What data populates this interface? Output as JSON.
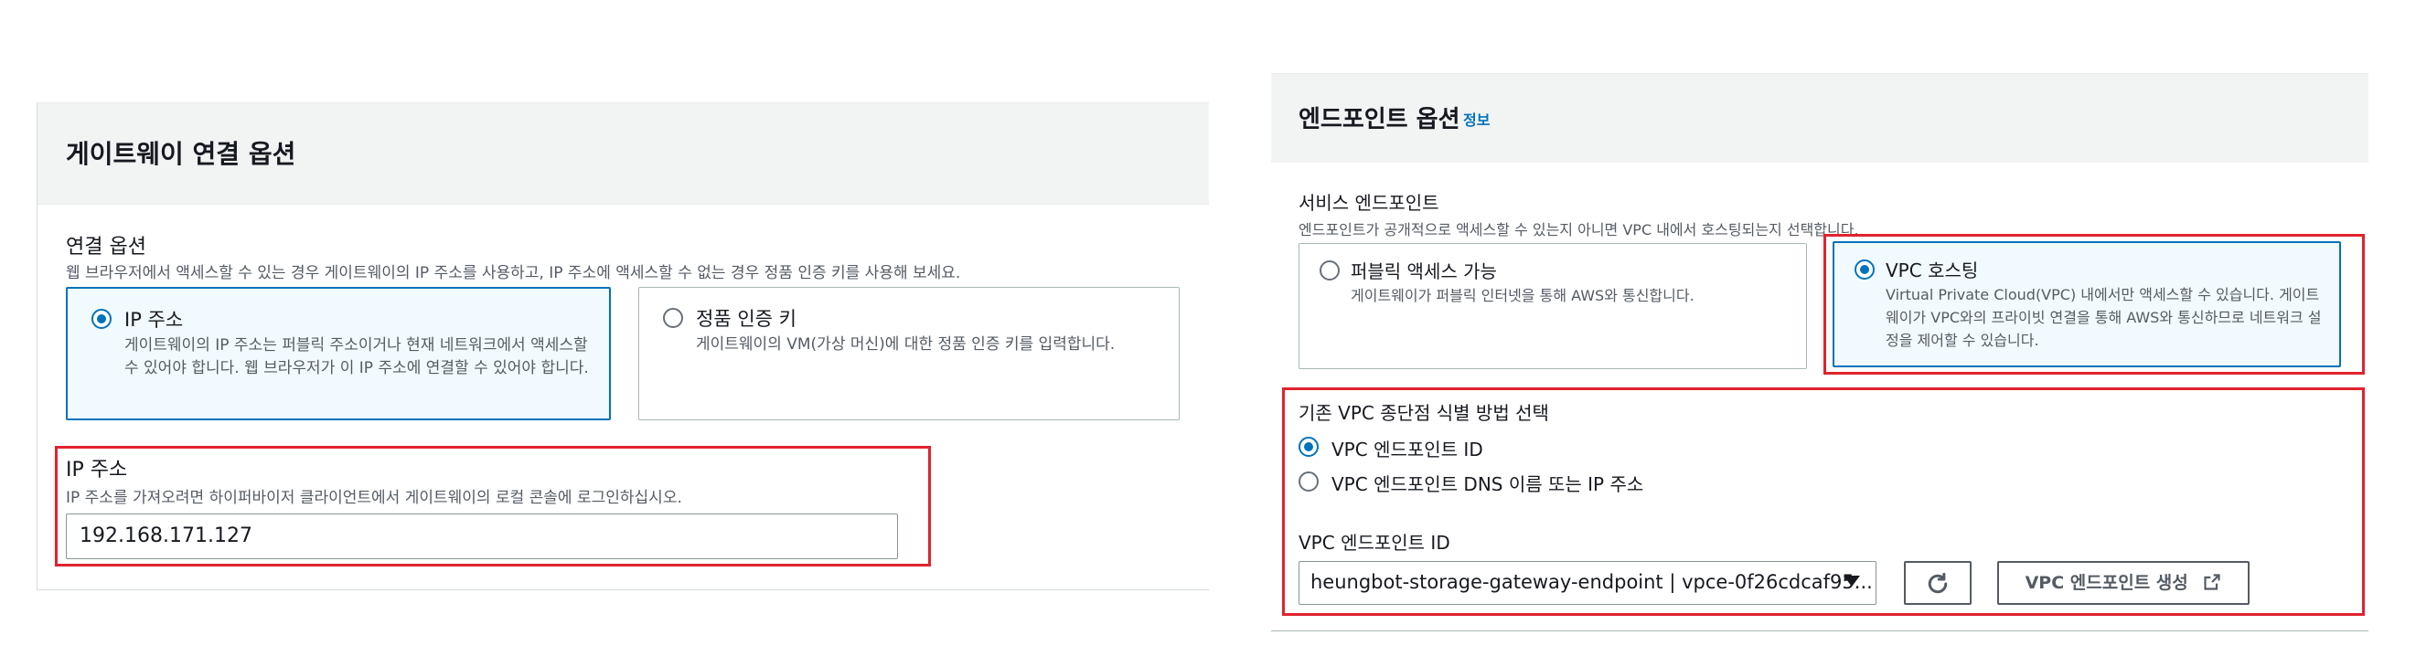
{
  "gateway_connection": {
    "title": "게이트웨이 연결 옵션",
    "connection_label": "연결 옵션",
    "connection_desc": "웹 브라우저에서 액세스할 수 있는 경우 게이트웨이의 IP 주소를 사용하고, IP 주소에 액세스할 수 없는 경우 정품 인증 키를 사용해 보세요.",
    "options": [
      {
        "title": "IP 주소",
        "desc": "게이트웨이의 IP 주소는 퍼블릭 주소이거나 현재 네트워크에서 액세스할 수 있어야 합니다. 웹 브라우저가 이 IP 주소에 연결할 수 있어야 합니다.",
        "selected": true
      },
      {
        "title": "정품 인증 키",
        "desc": "게이트웨이의 VM(가상 머신)에 대한 정품 인증 키를 입력합니다.",
        "selected": false
      }
    ],
    "ip_label": "IP 주소",
    "ip_desc": "IP 주소를 가져오려면 하이퍼바이저 클라이언트에서 게이트웨이의 로컬 콘솔에 로그인하십시오.",
    "ip_value": "192.168.171.127"
  },
  "endpoint_options": {
    "title": "엔드포인트 옵션",
    "info_link": "정보",
    "service_label": "서비스 엔드포인트",
    "service_desc": "엔드포인트가 공개적으로 액세스할 수 있는지 아니면 VPC 내에서 호스팅되는지 선택합니다.",
    "options": [
      {
        "title": "퍼블릭 액세스 가능",
        "desc": "게이트웨이가 퍼블릭 인터넷을 통해 AWS와 통신합니다.",
        "selected": false
      },
      {
        "title": "VPC 호스팅",
        "desc": "Virtual Private Cloud(VPC) 내에서만 액세스할 수 있습니다. 게이트웨이가 VPC와의 프라이빗 연결을 통해 AWS와 통신하므로 네트워크 설정을 제어할 수 있습니다.",
        "selected": true
      }
    ],
    "identify_label": "기존 VPC 종단점 식별 방법 선택",
    "identify_options": [
      {
        "label": "VPC 엔드포인트 ID",
        "selected": true
      },
      {
        "label": "VPC 엔드포인트 DNS 이름 또는 IP 주소",
        "selected": false
      }
    ],
    "endpoint_id_label": "VPC 엔드포인트 ID",
    "endpoint_select_value": "heungbot-storage-gateway-endpoint | vpce-0f26cdcaf95...",
    "create_button": "VPC 엔드포인트 생성"
  },
  "colors": {
    "accent": "#0073bb",
    "highlight": "#e1232e",
    "header_bg": "#f2f3f3"
  },
  "icons": [
    "refresh-icon",
    "external-link-icon",
    "caret-down-icon"
  ]
}
